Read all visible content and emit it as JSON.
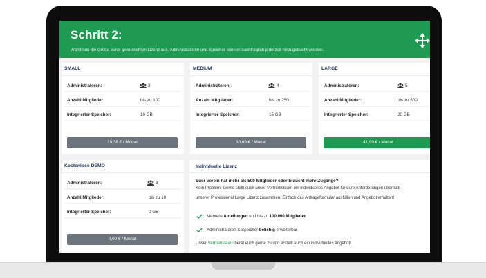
{
  "header": {
    "title": "Schritt 2:",
    "subtitle": "Wählt nun die Größe eurer gewünschten Lizenz aus. Administratoren und Speicher können nachträglich jederzeit hinzugebucht werden."
  },
  "labels": {
    "admins": "Administratoren:",
    "members": "Anzahl Mitglieder:",
    "storage": "Integrierter Speicher:"
  },
  "plans": [
    {
      "name": "SMALL",
      "admins": "3",
      "members": "bis zu 100",
      "storage": "10 GB",
      "price": "19,38 € / Monat"
    },
    {
      "name": "MEDIUM",
      "admins": "4",
      "members": "bis zu 250",
      "storage": "15 GB",
      "price": "30,69 € / Monat"
    },
    {
      "name": "LARGE",
      "admins": "5",
      "members": "bis zu 500",
      "storage": "20 GB",
      "price": "41,99 € / Monat"
    },
    {
      "name": "Kostenlose DEMO",
      "admins": "3",
      "members": "bis zu 10",
      "storage": "0 GB",
      "price": "0,00 € / Monat"
    }
  ],
  "individual": {
    "title": "Individuelle Lizenz",
    "question": "Euer Verein hat mehr als 500 Mitglieder oder braucht mehr Zugänge?",
    "line1": "Kein Problem! Gerne stellt euch unser Vertriebsteam ein individuelles Angebot für eure Anforderungen überhalb",
    "line2": "unserer Professional Large Lizenz zusammen. Einfach das Anfrageformular ausfüllen und Angebot erhalten!",
    "f1_pre": "Mehrere ",
    "f1_b1": "Abteilungen",
    "f1_mid": " und bis zu ",
    "f1_b2": "100.000 Mitglieder",
    "f2_pre": "Administratoren & Speicher ",
    "f2_b": "beliebig",
    "f2_post": " erweiterbar",
    "footer_pre": "Unser ",
    "footer_link": "Vertriebsteam",
    "footer_post": " berät euch gerne zu und erstellt euch ein individuelles Angebot!"
  },
  "colors": {
    "brand": "#1f9a52",
    "button_grey": "#6c757d",
    "title_navy": "#1d3357"
  },
  "icons": {
    "admins": "users-icon",
    "move": "move-arrows-icon",
    "check": "check-icon"
  }
}
